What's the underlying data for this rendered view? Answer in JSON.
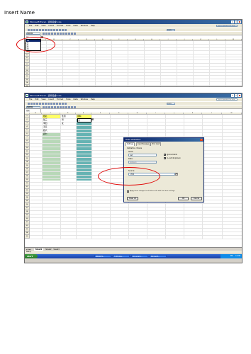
{
  "page": {
    "heading": "Insert Name"
  },
  "colors": {
    "title_bar": "#0a246a",
    "highlight_ring": "#e00000",
    "name_fill": "#ffff66",
    "gender_fill": "#66b3b3"
  },
  "screenshot1": {
    "title": "Microsoft Excel - 資料驗證1.xls",
    "menu": [
      "File",
      "Edit",
      "View",
      "Insert",
      "Format",
      "Tools",
      "Data",
      "Window",
      "Help"
    ],
    "help_placeholder": "Type a question for help",
    "zoom": "100%",
    "font": "新細明體",
    "name_box": "A1",
    "columns": [
      "A",
      "B",
      "C",
      "D",
      "E",
      "F",
      "G",
      "H",
      "I",
      "J",
      "K",
      "L",
      "M"
    ],
    "rows": [
      "1",
      "2",
      "3",
      "4",
      "5",
      "6",
      "7",
      "8",
      "9",
      "10",
      "11",
      "12",
      "13",
      "14",
      "15"
    ],
    "dropdown_items": [
      "A1",
      "性",
      "名",
      "性",
      "別"
    ],
    "dropdown_selected": "A1"
  },
  "screenshot2": {
    "title": "Microsoft Excel - 資料驗證1.xls",
    "menu": [
      "File",
      "Edit",
      "View",
      "Insert",
      "Format",
      "Tools",
      "Data",
      "Window",
      "Help"
    ],
    "help_placeholder": "Type a question for help",
    "zoom": "100%",
    "font": "新細明體",
    "name_box": "性別",
    "columns": [
      "B",
      "C",
      "D",
      "E",
      "F",
      "G",
      "H",
      "I",
      "J",
      "K",
      "L",
      "M"
    ],
    "rows": [
      "1",
      "2",
      "3",
      "4",
      "5",
      "6",
      "7",
      "8",
      "9",
      "10",
      "11",
      "12",
      "13",
      "14",
      "15",
      "16",
      "17",
      "18",
      "19",
      "20",
      "21",
      "22",
      "23",
      "24",
      "25",
      "26",
      "27",
      "28",
      "29",
      "30",
      "31",
      "32",
      "33",
      "34",
      "35"
    ],
    "table": {
      "headers": [
        "姓名",
        "性別",
        "資料"
      ],
      "rows": [
        [
          "張三",
          "男",
          "男"
        ],
        [
          "李四",
          "女",
          ""
        ],
        [
          "王五",
          "",
          ""
        ],
        [
          "趙六",
          "",
          ""
        ],
        [
          "錢七",
          "",
          ""
        ]
      ]
    },
    "sheet_tabs": [
      "Sheet1",
      "Sheet2",
      "Sheet3"
    ],
    "status": "Ready",
    "taskbar": {
      "start": "start",
      "items": [
        "資料驗證1...",
        "3 Window...",
        "Document...",
        "Microsoft..."
      ],
      "clock": "12:38",
      "lang": "EN"
    },
    "dialog": {
      "title": "Data Validation",
      "tabs": [
        "Settings",
        "Input Message",
        "Error Alert"
      ],
      "criteria_label": "Validation criteria",
      "allow_label": "Allow:",
      "allow_value": "List",
      "data_label": "Data:",
      "data_value": "between",
      "ignore_blank": "Ignore blank",
      "in_cell_dropdown": "In-cell dropdown",
      "source_label": "Source:",
      "source_value": "=性別",
      "apply_all": "Apply these changes to all other cells with the same settings",
      "clear_all": "Clear All",
      "ok": "OK",
      "cancel": "Cancel"
    }
  }
}
